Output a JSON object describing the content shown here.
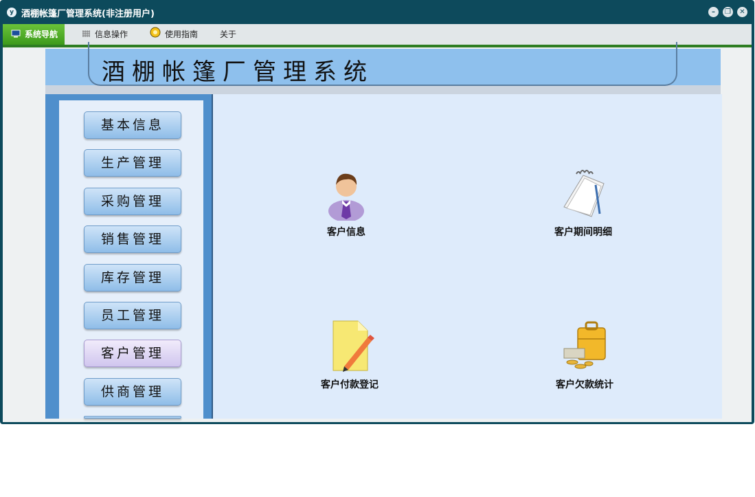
{
  "window": {
    "title": "酒棚帐篷厂管理系统(非注册用户)",
    "logo_text": "y"
  },
  "menu": [
    {
      "label": "系统导航",
      "icon": "monitor-icon",
      "active": true
    },
    {
      "label": "信息操作",
      "icon": "grid-icon",
      "active": false
    },
    {
      "label": "使用指南",
      "icon": "help-icon",
      "active": false
    },
    {
      "label": "关于",
      "icon": "",
      "active": false
    }
  ],
  "banner": {
    "title": "酒棚帐篷厂管理系统"
  },
  "sidebar": [
    {
      "label": "基本信息"
    },
    {
      "label": "生产管理"
    },
    {
      "label": "采购管理"
    },
    {
      "label": "销售管理"
    },
    {
      "label": "库存管理"
    },
    {
      "label": "员工管理"
    },
    {
      "label": "客户管理",
      "selected": true
    },
    {
      "label": "供商管理"
    }
  ],
  "tiles": [
    {
      "label": "客户信息",
      "icon": "customer-person-icon"
    },
    {
      "label": "客户期间明细",
      "icon": "notepad-icon"
    },
    {
      "label": "客户付款登记",
      "icon": "document-pencil-icon"
    },
    {
      "label": "客户欠款统计",
      "icon": "briefcase-money-icon"
    }
  ]
}
